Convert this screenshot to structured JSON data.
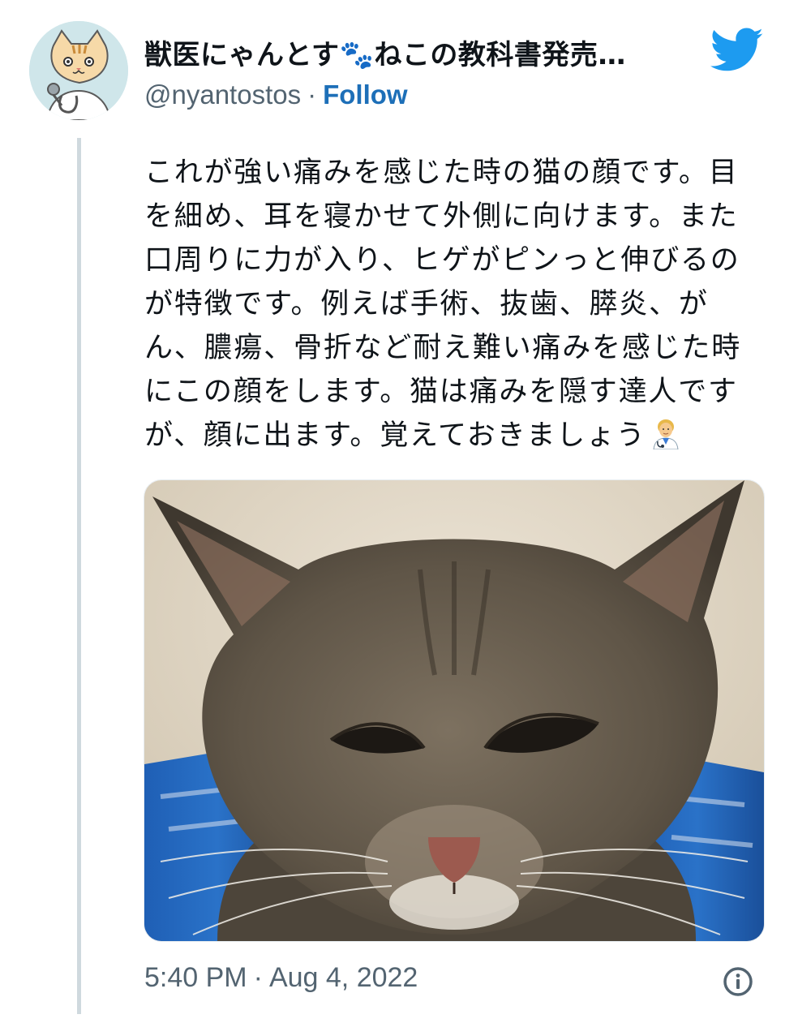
{
  "author": {
    "display_name": "獣医にゃんとす🐾ねこの教科書発売…",
    "handle": "@nyantostos",
    "separator": "·",
    "follow_label": "Follow"
  },
  "icons": {
    "avatar": "cat-veterinarian-avatar",
    "brand": "twitter-bird-icon",
    "emoji": "health-worker-emoji",
    "info": "info-icon"
  },
  "tweet": {
    "text_lines": [
      "これが強い痛みを感じた時の猫の顔です。目",
      "を細め、耳を寝かせて外側に向けます。また",
      "口周りに力が入り、ヒゲがピンっと伸びるの",
      "が特徴です。例えば手術、抜歯、膵炎、が",
      "ん、膿瘍、骨折など耐え難い痛みを感じた時",
      "にこの顔をします。猫は痛みを隠す達人です",
      "が、顔に出ます。覚えておきましょう"
    ],
    "trailing_emoji": "🧑‍⚕️",
    "photo_alt": "cat-in-pain-photo"
  },
  "meta": {
    "time": "5:40 PM",
    "separator": "·",
    "date": "Aug 4, 2022"
  },
  "colors": {
    "follow": "#1d6fb8",
    "twitter_blue": "#1d9bf0",
    "secondary_text": "#536471",
    "thread_line": "#cfd9de"
  }
}
